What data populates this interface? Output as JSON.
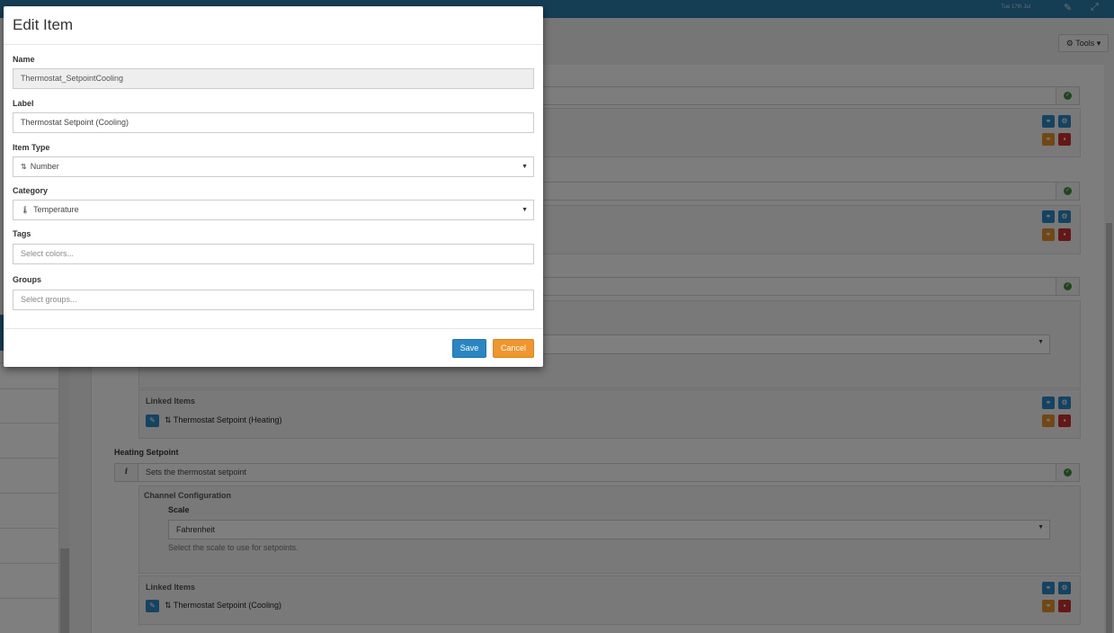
{
  "background": {
    "date": "Tue 17th Jul",
    "tools_label": "⚙ Tools ▾",
    "channels": [
      {
        "title": "Heating Setpoint",
        "description": "Sets the thermostat setpoint",
        "config_title": "Channel Configuration",
        "scale_label": "Scale",
        "scale_value": "Fahrenheit",
        "scale_help": "Select the scale to use for setpoints.",
        "linked_title": "Linked Items",
        "linked_item": "Thermostat Setpoint (Cooling)"
      }
    ],
    "upper_linked": {
      "linked_title": "Linked Items",
      "linked_item": "Thermostat Setpoint (Heating)"
    }
  },
  "modal": {
    "title": "Edit Item",
    "fields": {
      "name": {
        "label": "Name",
        "value": "Thermostat_SetpointCooling"
      },
      "label": {
        "label": "Label",
        "value": "Thermostat Setpoint (Cooling)"
      },
      "item_type": {
        "label": "Item Type",
        "value": "Number",
        "icon": "sort-numeric-icon"
      },
      "category": {
        "label": "Category",
        "value": "Temperature",
        "icon": "thermometer-icon"
      },
      "tags": {
        "label": "Tags",
        "placeholder": "Select colors..."
      },
      "groups": {
        "label": "Groups",
        "placeholder": "Select groups..."
      }
    },
    "buttons": {
      "save": "Save",
      "cancel": "Cancel"
    }
  },
  "colors": {
    "primary": "#2a86c2",
    "warning": "#f0962e",
    "danger": "#c9302c",
    "success": "#3c8f3c",
    "topbar": "#2a7aa8"
  }
}
